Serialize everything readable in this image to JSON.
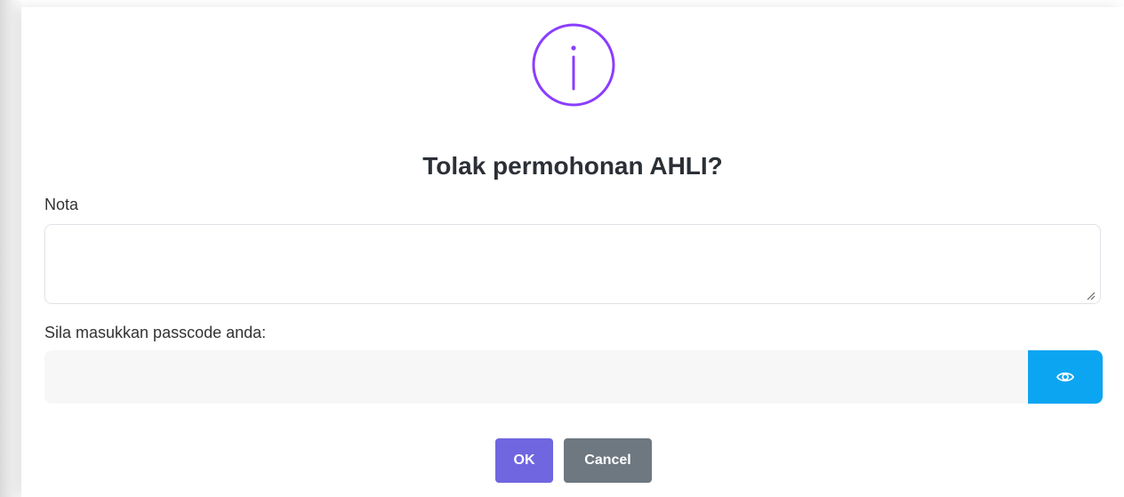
{
  "dialog": {
    "icon": "info-icon",
    "icon_color": "#8b3dff",
    "title": "Tolak permohonan AHLI?",
    "note": {
      "label": "Nota",
      "value": "",
      "placeholder": ""
    },
    "passcode": {
      "label": "Sila masukkan passcode anda:",
      "value": "",
      "placeholder": "",
      "toggle_icon": "eye-icon",
      "toggle_color": "#0ca5f2"
    },
    "buttons": {
      "ok_label": "OK",
      "ok_color": "#7066e0",
      "cancel_label": "Cancel",
      "cancel_color": "#6e7881"
    }
  }
}
